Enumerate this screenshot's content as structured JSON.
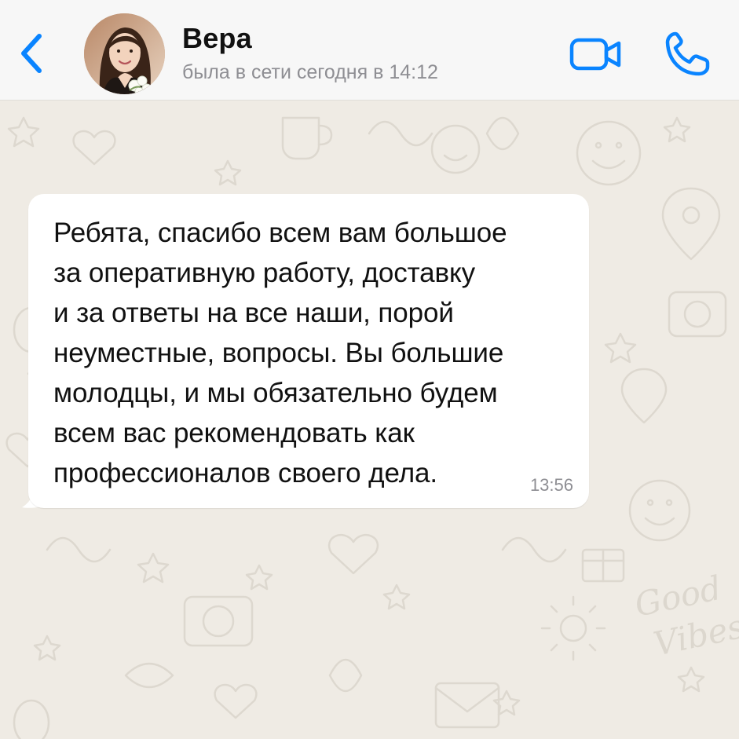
{
  "colors": {
    "accent": "#0a84ff",
    "header_bg": "#f7f7f7",
    "wallpaper_bg": "#efebe4",
    "doodle": "#ddd8cf",
    "bubble_bg": "#ffffff",
    "secondary_text": "#8e8e93"
  },
  "header": {
    "back_icon": "chevron-left-icon",
    "contact_name": "Вера",
    "last_seen": "была в сети сегодня в 14:12",
    "video_icon": "video-camera-icon",
    "call_icon": "phone-icon"
  },
  "wallpaper": {
    "doodle_text": [
      "Good",
      "Vibes"
    ]
  },
  "message": {
    "text": "Ребята, спасибо всем вам большое\nза оперативную работу, доставку\nи за ответы на все наши, порой\nнеуместные, вопросы. Вы большие\nмолодцы, и мы обязательно будем\nвсем вас рекомендовать как\nпрофессионалов своего дела.",
    "time": "13:56"
  }
}
